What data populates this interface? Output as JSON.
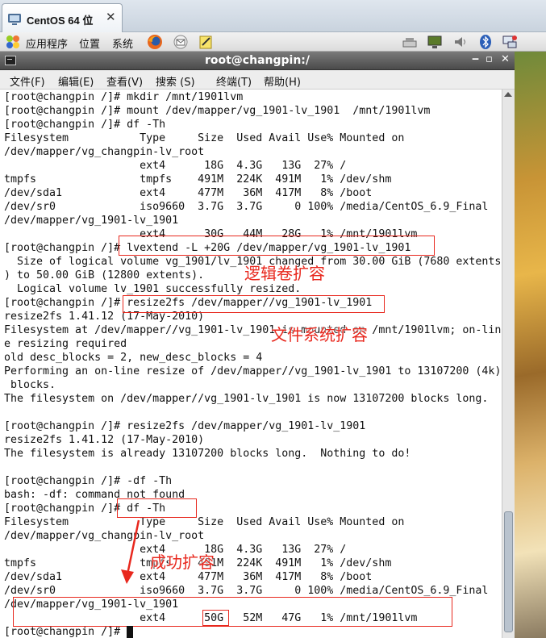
{
  "vm_tab": {
    "title": "CentOS 64 位",
    "close": "✕"
  },
  "panel": {
    "applications": "应用程序",
    "places": "位置",
    "system": "系统"
  },
  "terminal": {
    "title": "root@changpin:/",
    "menu": [
      "文件(F)",
      "编辑(E)",
      "查看(V)",
      "搜索 (S)",
      "终端(T)",
      "帮助(H)"
    ],
    "lines": [
      "[root@changpin /]# mkdir /mnt/1901lvm",
      "[root@changpin /]# mount /dev/mapper/vg_1901-lv_1901  /mnt/1901lvm",
      "[root@changpin /]# df -Th",
      "Filesystem           Type     Size  Used Avail Use% Mounted on",
      "/dev/mapper/vg_changpin-lv_root",
      "                     ext4      18G  4.3G   13G  27% /",
      "tmpfs                tmpfs    491M  224K  491M   1% /dev/shm",
      "/dev/sda1            ext4     477M   36M  417M   8% /boot",
      "/dev/sr0             iso9660  3.7G  3.7G     0 100% /media/CentOS_6.9_Final",
      "/dev/mapper/vg_1901-lv_1901",
      "                     ext4      30G   44M   28G   1% /mnt/1901lvm",
      "[root@changpin /]# lvextend -L +20G /dev/mapper/vg_1901-lv_1901",
      "  Size of logical volume vg_1901/lv_1901 changed from 30.00 GiB (7680 extents",
      ") to 50.00 GiB (12800 extents).",
      "  Logical volume lv_1901 successfully resized.",
      "[root@changpin /]# resize2fs /dev/mapper//vg_1901-lv_1901",
      "resize2fs 1.41.12 (17-May-2010)",
      "Filesystem at /dev/mapper//vg_1901-lv_1901 is mounted on /mnt/1901lvm; on-lin",
      "e resizing required",
      "old desc_blocks = 2, new_desc_blocks = 4",
      "Performing an on-line resize of /dev/mapper//vg_1901-lv_1901 to 13107200 (4k)",
      " blocks.",
      "The filesystem on /dev/mapper//vg_1901-lv_1901 is now 13107200 blocks long.",
      "",
      "[root@changpin /]# resize2fs /dev/mapper/vg_1901-lv_1901",
      "resize2fs 1.41.12 (17-May-2010)",
      "The filesystem is already 13107200 blocks long.  Nothing to do!",
      "",
      "[root@changpin /]# -df -Th",
      "bash: -df: command not found",
      "[root@changpin /]# df -Th",
      "Filesystem           Type     Size  Used Avail Use% Mounted on",
      "/dev/mapper/vg_changpin-lv_root",
      "                     ext4      18G  4.3G   13G  27% /",
      "tmpfs                tmpfs    491M  224K  491M   1% /dev/shm",
      "/dev/sda1            ext4     477M   36M  417M   8% /boot",
      "/dev/sr0             iso9660  3.7G  3.7G     0 100% /media/CentOS_6.9_Final",
      "/dev/mapper/vg_1901-lv_1901",
      "                     ext4      50G   52M   47G   1% /mnt/1901lvm",
      "[root@changpin /]# "
    ]
  },
  "annotations": {
    "lv_extend": "逻辑卷扩容",
    "fs_extend": "文件系统扩容",
    "success": "成功扩容",
    "color": "#e8281e"
  }
}
